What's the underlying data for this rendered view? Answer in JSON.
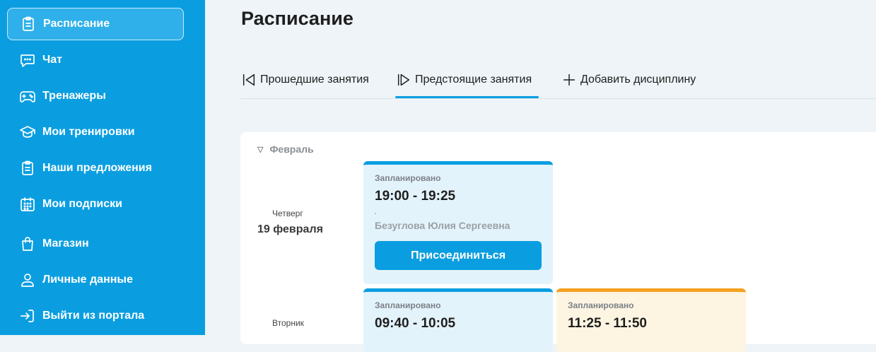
{
  "sidebar": {
    "items": [
      {
        "label": "Расписание",
        "icon": "clipboard-icon",
        "active": true
      },
      {
        "label": "Чат",
        "icon": "chat-icon"
      },
      {
        "label": "Тренажеры",
        "icon": "gamepad-icon"
      },
      {
        "label": "Мои тренировки",
        "icon": "graduation-cap-icon"
      },
      {
        "label": "Наши предложения",
        "icon": "clipboard-icon"
      },
      {
        "label": "Мои подписки",
        "icon": "calendar-icon"
      },
      {
        "label": "Магазин",
        "icon": "shopping-bag-icon"
      },
      {
        "label": "Личные данные",
        "icon": "user-icon"
      },
      {
        "label": "Выйти из портала",
        "icon": "logout-icon"
      }
    ]
  },
  "header": {
    "title": "Расписание"
  },
  "tabs": [
    {
      "label": "Прошедшие занятия",
      "icon": "rewind-icon"
    },
    {
      "label": "Предстоящие занятия",
      "icon": "play-icon",
      "active": true
    },
    {
      "label": "Добавить дисциплину",
      "icon": "plus-icon"
    }
  ],
  "schedule": {
    "month": "Февраль",
    "days": [
      {
        "weekday": "Четверг",
        "date": "19 февраля",
        "lessons": [
          {
            "status": "Запланировано",
            "time": "19:00 - 19:25",
            "teacher": "Безуглова Юлия Сергеевна",
            "button": "Присоединиться"
          }
        ]
      },
      {
        "weekday": "Вторник",
        "lessons": [
          {
            "status": "Запланировано",
            "time": "09:40 - 10:05"
          },
          {
            "status": "Запланировано",
            "time": "11:25 - 11:50"
          }
        ]
      }
    ]
  },
  "colors": {
    "accent": "#0a9ee0",
    "orange": "#f5a11d"
  }
}
